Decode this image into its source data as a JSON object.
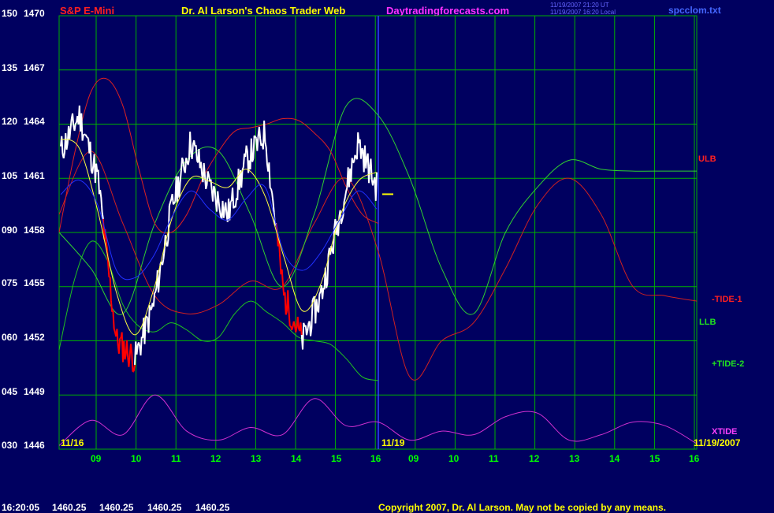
{
  "header": {
    "title": "S&P E-Mini",
    "author": "Dr. Al Larson's Chaos Trader Web",
    "site": "Daytradingforecasts.com",
    "stamp_line1": "11/19/2007 21:20 UT",
    "stamp_line2": "11/19/2007 16:20 Local",
    "file": "spcclom.txt"
  },
  "colors": {
    "background": "#000060",
    "grid": "#00b000",
    "price": "#ffffff",
    "down_bars": "#ff0000",
    "ulb": "#dd2020",
    "llb": "#20c020",
    "tide1": "#d02020",
    "tide2": "#30d030",
    "xtide": "#d030d0",
    "average": "#2030ff",
    "smooth": "#ffff40"
  },
  "chart_data": {
    "type": "line",
    "title": "S&P E-Mini",
    "y_left_ticks": [
      "150",
      "135",
      "120",
      "105",
      "090",
      "075",
      "060",
      "045",
      "030"
    ],
    "y_right_ticks": [
      "1470",
      "1467",
      "1464",
      "1461",
      "1458",
      "1455",
      "1452",
      "1449",
      "1446"
    ],
    "ylim": [
      1446,
      1470
    ],
    "x_ticks": [
      "09",
      "10",
      "11",
      "12",
      "13",
      "14",
      "15",
      "16",
      "09",
      "10",
      "11",
      "12",
      "13",
      "14",
      "15",
      "16"
    ],
    "session_labels": [
      "11/16",
      "11/19",
      "11/19/2007"
    ],
    "last_price": 1460.25,
    "series": [
      {
        "name": "ULB",
        "values": [
          1458.0,
          1462.5,
          1465.8,
          1466.5,
          1465.0,
          1461.5,
          1458.5,
          1458.0,
          1459.0,
          1461.0,
          1462.5,
          1463.6,
          1463.8,
          1464.0,
          1464.3,
          1464.2,
          1463.5,
          1462.5,
          1460.5,
          1459.0,
          1458.5
        ]
      },
      {
        "name": "LLB",
        "values": [
          1451.5,
          1455.5,
          1457.5,
          1456.5,
          1454.0,
          1452.8,
          1452.5,
          1453.0,
          1452.6,
          1452.0,
          1452.2,
          1453.5,
          1454.2,
          1453.6,
          1453.0,
          1452.2,
          1452.0,
          1451.8,
          1451.0,
          1450.0,
          1449.8
        ]
      },
      {
        "name": "-TIDE-1",
        "values": [
          1459.0,
          1462.5,
          1458.5,
          1454.5,
          1453.5,
          1454.0,
          1455.3,
          1455.0,
          1458.5,
          1461.0,
          1457.0,
          1450.0,
          1452.0,
          1453.0,
          1456.0,
          1459.5,
          1461.0,
          1459.0,
          1455.0,
          1454.5,
          1454.2
        ]
      },
      {
        "name": "+TIDE-2",
        "values": [
          1458.0,
          1456.0,
          1453.5,
          1458.5,
          1462.0,
          1462.5,
          1459.0,
          1455.0,
          1459.0,
          1465.0,
          1464.5,
          1461.0,
          1456.0,
          1453.5,
          1458.0,
          1460.5,
          1462.0,
          1461.5,
          1461.4,
          1461.4,
          1461.4
        ]
      },
      {
        "name": "XTIDE",
        "values": [
          1446.2,
          1447.6,
          1446.8,
          1449.0,
          1447.0,
          1446.5,
          1447.2,
          1446.8,
          1448.8,
          1447.3,
          1447.5,
          1446.5,
          1447.0,
          1446.8,
          1447.8,
          1448.0,
          1446.5,
          1446.8,
          1447.5,
          1447.3,
          1446.3
        ]
      },
      {
        "name": "price",
        "values": [
          1462.5,
          1464.5,
          1461.0,
          1452.0,
          1451.0,
          1454.0,
          1459.5,
          1463.0,
          1460.5,
          1459.0,
          1462.0,
          1463.5,
          1454.5,
          1452.0,
          1454.5,
          1459.0,
          1463.0,
          1460.5
        ]
      }
    ]
  },
  "labels": {
    "ulb": "ULB",
    "tide1": "-TIDE-1",
    "llb": "LLB",
    "tide2": "+TIDE-2",
    "xtide": "XTIDE"
  },
  "footer": {
    "time": "16:20:05",
    "prices": [
      "1460.25",
      "1460.25",
      "1460.25",
      "1460.25"
    ],
    "copyright": "Copyright 2007, Dr. Al Larson. May not be copied by any means."
  }
}
